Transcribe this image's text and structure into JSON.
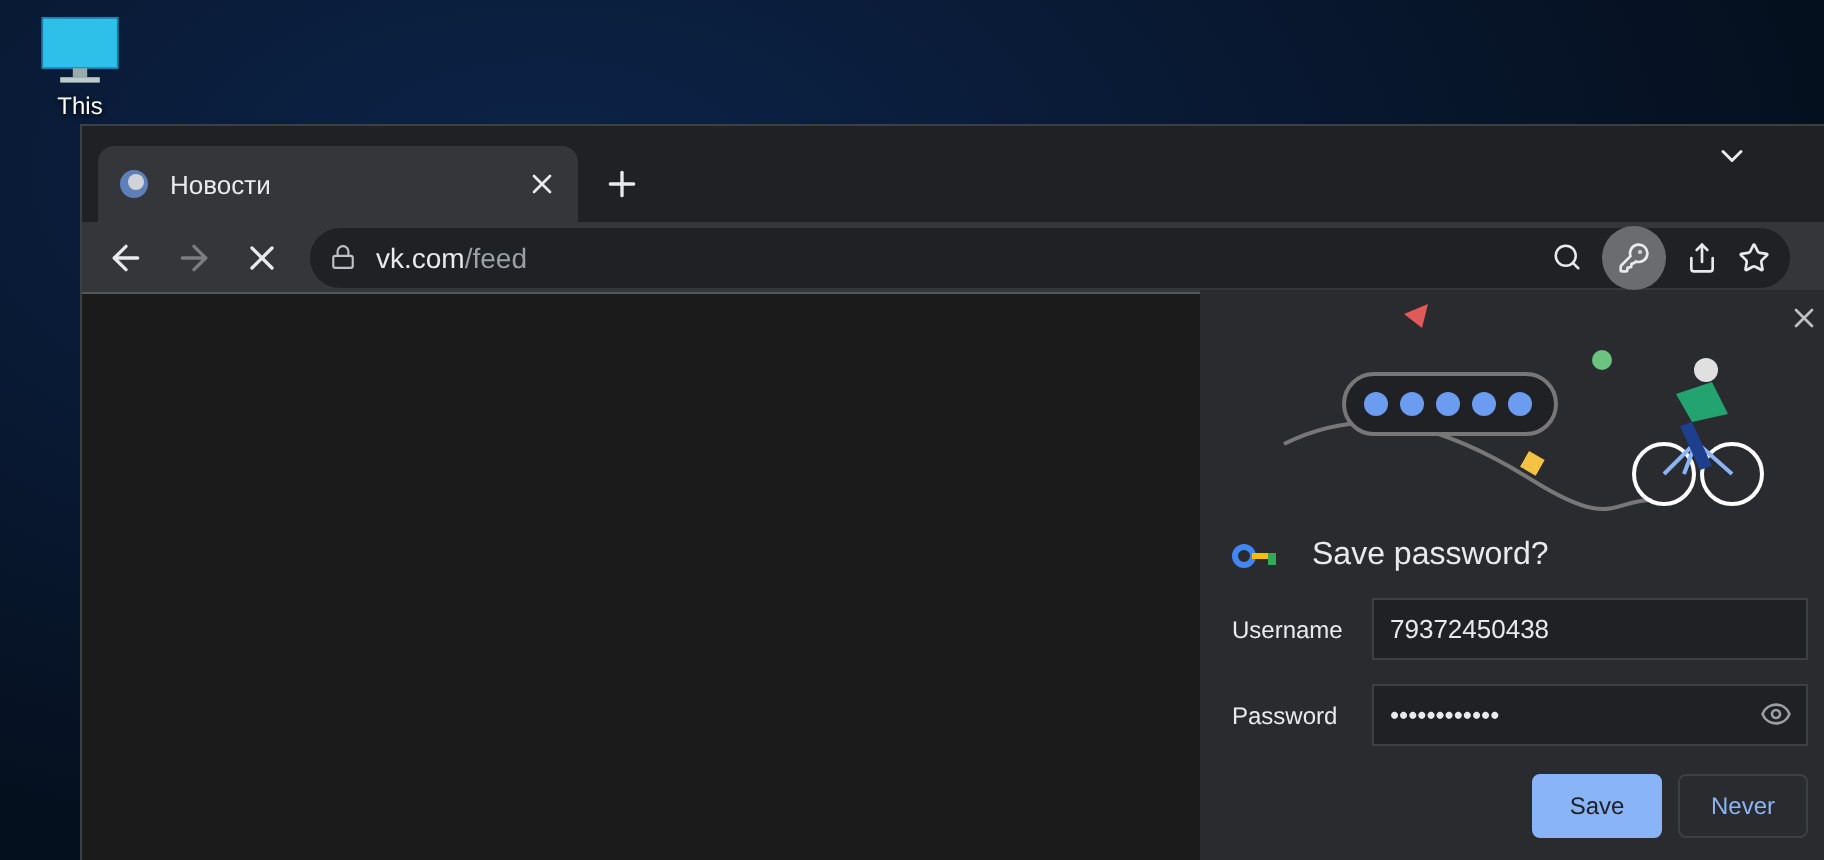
{
  "desktop": {
    "icons": [
      {
        "label": "This"
      }
    ]
  },
  "browser": {
    "tabs": [
      {
        "title": "Новости",
        "selected": true
      }
    ],
    "address": {
      "host": "vk.com",
      "path": "/feed"
    },
    "toolbar": {
      "key_active": true
    }
  },
  "popup": {
    "title": "Save password?",
    "fields": [
      {
        "label": "Username",
        "value": "79372450438",
        "kind": "text"
      },
      {
        "label": "Password",
        "value": "••••••••••••",
        "kind": "password"
      }
    ],
    "buttons": [
      {
        "label": "Save",
        "kind": "primary"
      },
      {
        "label": "Never",
        "kind": "secondary"
      }
    ]
  }
}
